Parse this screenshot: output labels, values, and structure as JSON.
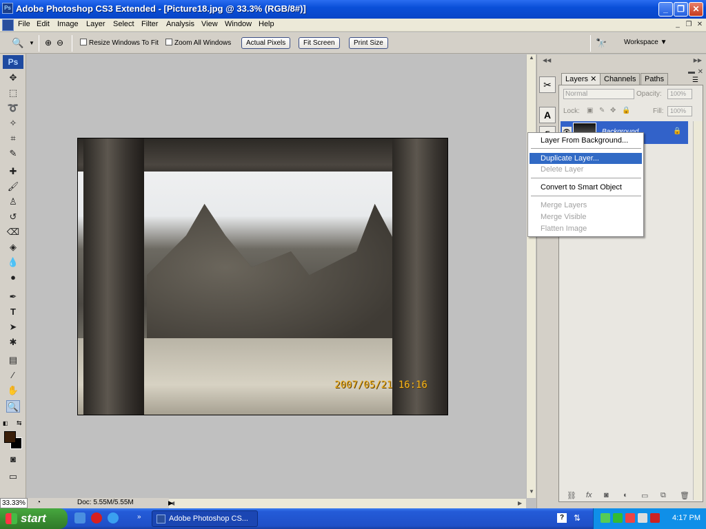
{
  "window": {
    "title": "Adobe Photoshop CS3 Extended - [Picture18.jpg @ 33.3% (RGB/8#)]",
    "app_icon_text": "Ps"
  },
  "menu": [
    "File",
    "Edit",
    "Image",
    "Layer",
    "Select",
    "Filter",
    "Analysis",
    "View",
    "Window",
    "Help"
  ],
  "options": {
    "resize_windows": "Resize Windows To Fit",
    "zoom_all": "Zoom All Windows",
    "actual_pixels": "Actual Pixels",
    "fit_screen": "Fit Screen",
    "print_size": "Print Size",
    "workspace": "Workspace"
  },
  "tools": {
    "logo": "Ps"
  },
  "image": {
    "stamp": "2007/05/21  16:16"
  },
  "status": {
    "zoom": "33.33%",
    "doc": "Doc: 5.55M/5.55M"
  },
  "layers_panel": {
    "tabs": [
      "Layers",
      "Channels",
      "Paths"
    ],
    "blend_mode": "Normal",
    "opacity_label": "Opacity:",
    "opacity_value": "100%",
    "lock_label": "Lock:",
    "fill_label": "Fill:",
    "fill_value": "100%",
    "layer_name": "Background"
  },
  "context_menu": {
    "items": [
      {
        "label": "Layer From Background...",
        "enabled": true
      },
      {
        "label": "Duplicate Layer...",
        "enabled": true,
        "highlighted": true
      },
      {
        "label": "Delete Layer",
        "enabled": false
      },
      {
        "label": "Convert to Smart Object",
        "enabled": true
      },
      {
        "label": "Merge Layers",
        "enabled": false
      },
      {
        "label": "Merge Visible",
        "enabled": false
      },
      {
        "label": "Flatten Image",
        "enabled": false
      }
    ]
  },
  "taskbar": {
    "start": "start",
    "task_label": "Adobe Photoshop CS...",
    "clock": "4:17 PM"
  }
}
